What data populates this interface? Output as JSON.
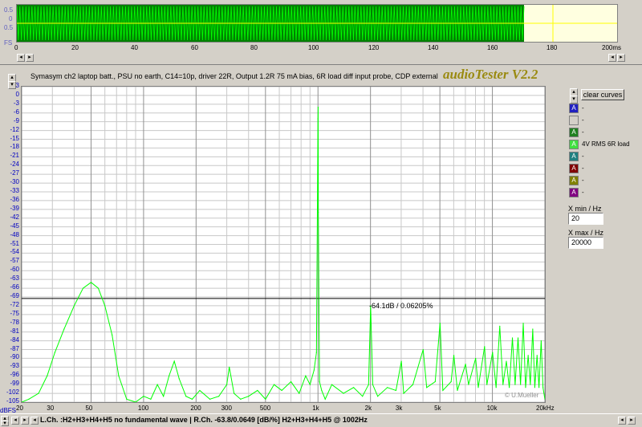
{
  "top_scope": {
    "y_labels": [
      "0.5",
      "0",
      "0.5",
      "FS"
    ],
    "x_ticks": [
      "0",
      "20",
      "40",
      "60",
      "80",
      "100",
      "120",
      "140",
      "160",
      "180"
    ],
    "x_unit_label": "200ms",
    "colors": {
      "signal": "#00ff00",
      "bg_active": "#008000",
      "bg_empty": "#ffffe0",
      "marker": "#ffff00"
    }
  },
  "caption": "Symasym ch2 laptop batt., PSU no earth, C14=10p, driver 22R, Output 1.2R 75 mA bias, 6R load diff input probe, CDP external",
  "brand": "audioTester V2.2",
  "copyright": "© U.Mueller",
  "cursor_readout": "-64.1dB / 0.06205%",
  "status_bar": "L.Ch. :H2+H3+H4+H5 no fundamental wave | R.Ch. -63.8/0.0649 [dB/%] H2+H3+H4+H5 @ 1002Hz",
  "right_panel": {
    "clear_button": "clear curves",
    "channels": [
      {
        "label": "A",
        "text": "-",
        "color": "#2020c0"
      },
      {
        "label": "",
        "text": "-",
        "color": "#d4d0c8"
      },
      {
        "label": "A",
        "text": "-",
        "color": "#208020"
      },
      {
        "label": "A",
        "text": "4V RMS 6R load",
        "color": "#40e040"
      },
      {
        "label": "A",
        "text": "-",
        "color": "#208080"
      },
      {
        "label": "A",
        "text": "-",
        "color": "#800000"
      },
      {
        "label": "A",
        "text": "-",
        "color": "#808000"
      },
      {
        "label": "A",
        "text": "-",
        "color": "#800080"
      }
    ],
    "xmin_label": "X min / Hz",
    "xmin_value": "20",
    "xmax_label": "X max / Hz",
    "xmax_value": "20000"
  },
  "chart_data": {
    "type": "line",
    "title": "",
    "xlabel": "",
    "ylabel": "dBFS",
    "x_scale": "log",
    "xlim": [
      20,
      20000
    ],
    "ylim": [
      -105,
      3
    ],
    "grid": true,
    "y_ticks": [
      "3",
      "0",
      "-3",
      "-6",
      "-9",
      "-12",
      "-15",
      "-18",
      "-21",
      "-24",
      "-27",
      "-30",
      "-33",
      "-36",
      "-39",
      "-42",
      "-45",
      "-48",
      "-51",
      "-54",
      "-57",
      "-60",
      "-63",
      "-66",
      "-69",
      "-72",
      "-75",
      "-78",
      "-81",
      "-84",
      "-87",
      "-90",
      "-93",
      "-96",
      "-99",
      "-102",
      "-105"
    ],
    "x_ticks": [
      {
        "v": 20,
        "label": "20"
      },
      {
        "v": 30,
        "label": "30"
      },
      {
        "v": 50,
        "label": "50"
      },
      {
        "v": 100,
        "label": "100"
      },
      {
        "v": 200,
        "label": "200"
      },
      {
        "v": 300,
        "label": "300"
      },
      {
        "v": 500,
        "label": "500"
      },
      {
        "v": 1000,
        "label": "1k"
      },
      {
        "v": 2000,
        "label": "2k"
      },
      {
        "v": 3000,
        "label": "3k"
      },
      {
        "v": 5000,
        "label": "5k"
      },
      {
        "v": 10000,
        "label": "10k"
      },
      {
        "v": 20000,
        "label": "20kHz"
      }
    ],
    "cursor_level_db": -69.5,
    "series": [
      {
        "color": "#00ff00",
        "x": [
          20,
          22,
          25,
          28,
          31,
          35,
          40,
          45,
          50,
          55,
          60,
          66,
          72,
          80,
          90,
          100,
          110,
          120,
          130,
          140,
          150,
          160,
          175,
          190,
          210,
          240,
          270,
          300,
          310,
          330,
          360,
          400,
          450,
          500,
          560,
          620,
          700,
          780,
          850,
          900,
          950,
          980,
          1000,
          1002,
          1005,
          1020,
          1050,
          1100,
          1200,
          1400,
          1600,
          1800,
          1950,
          2004,
          2060,
          2200,
          2500,
          2800,
          3006,
          3100,
          3500,
          4008,
          4200,
          4700,
          5010,
          5200,
          5800,
          6012,
          6300,
          7014,
          7300,
          8016,
          8300,
          9018,
          9300,
          10020,
          10500,
          11022,
          11500,
          12024,
          12500,
          13026,
          13500,
          14028,
          14500,
          15030,
          15500,
          16032,
          16500,
          17034,
          17500,
          18036,
          18500,
          19038,
          19500,
          20000
        ],
        "y": [
          -105,
          -104,
          -102,
          -96,
          -88,
          -80,
          -72,
          -66,
          -64,
          -66,
          -72,
          -82,
          -96,
          -104,
          -105,
          -103,
          -104,
          -99,
          -103,
          -96,
          -91,
          -97,
          -103,
          -104,
          -101,
          -104,
          -103,
          -99,
          -93,
          -102,
          -104,
          -103,
          -101,
          -104,
          -99,
          -101,
          -98,
          -102,
          -96,
          -99,
          -94,
          -88,
          -8,
          -4,
          -40,
          -98,
          -101,
          -104,
          -99,
          -102,
          -100,
          -103,
          -99,
          -72,
          -99,
          -103,
          -100,
          -101,
          -91,
          -102,
          -99,
          -87,
          -100,
          -98,
          -78,
          -101,
          -98,
          -89,
          -101,
          -92,
          -99,
          -90,
          -100,
          -86,
          -99,
          -88,
          -100,
          -79,
          -99,
          -91,
          -100,
          -83,
          -99,
          -83,
          -99,
          -78,
          -100,
          -89,
          -99,
          -80,
          -100,
          -89,
          -100,
          -84,
          -100,
          -104
        ]
      }
    ]
  }
}
